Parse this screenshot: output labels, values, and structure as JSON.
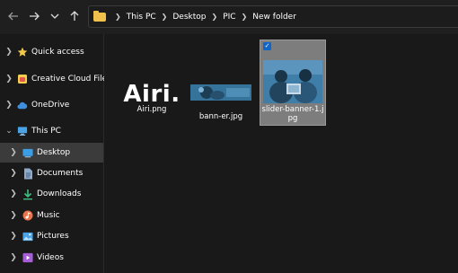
{
  "nav": {
    "back_icon": "arrow-left-icon",
    "forward_icon": "arrow-right-icon",
    "recent_icon": "chevron-down-icon",
    "up_icon": "arrow-up-icon"
  },
  "address": {
    "folder_icon": "folder-icon",
    "crumbs": [
      "This PC",
      "Desktop",
      "PIC",
      "New folder"
    ]
  },
  "sidebar": {
    "items": [
      {
        "label": "Quick access",
        "icon": "star-icon",
        "color": "#f2c94c"
      },
      {
        "label": "Creative Cloud Files",
        "icon": "creative-cloud-icon",
        "color": "#e8554d"
      },
      {
        "label": "OneDrive",
        "icon": "cloud-icon",
        "color": "#3f8fdd"
      },
      {
        "label": "This PC",
        "icon": "computer-icon",
        "color": "#4aa3e6"
      },
      {
        "label": "Desktop",
        "icon": "desktop-icon",
        "color": "#3a9de6"
      },
      {
        "label": "Documents",
        "icon": "document-icon",
        "color": "#8fa9c9"
      },
      {
        "label": "Downloads",
        "icon": "download-icon",
        "color": "#3fbf7f"
      },
      {
        "label": "Music",
        "icon": "music-icon",
        "color": "#e8734d"
      },
      {
        "label": "Pictures",
        "icon": "picture-icon",
        "color": "#4aa3e6"
      },
      {
        "label": "Videos",
        "icon": "video-icon",
        "color": "#a65ed6"
      }
    ]
  },
  "files": [
    {
      "name": "Airi.png",
      "thumb_text": "Airi.",
      "selected": false
    },
    {
      "name": "bann-er.jpg",
      "selected": false
    },
    {
      "name_line1": "slider-banner-1.j",
      "name_line2": "pg",
      "selected": true
    }
  ],
  "colors": {
    "accent": "#0f66c8",
    "background": "#191919",
    "selection": "#7d7d7d"
  }
}
